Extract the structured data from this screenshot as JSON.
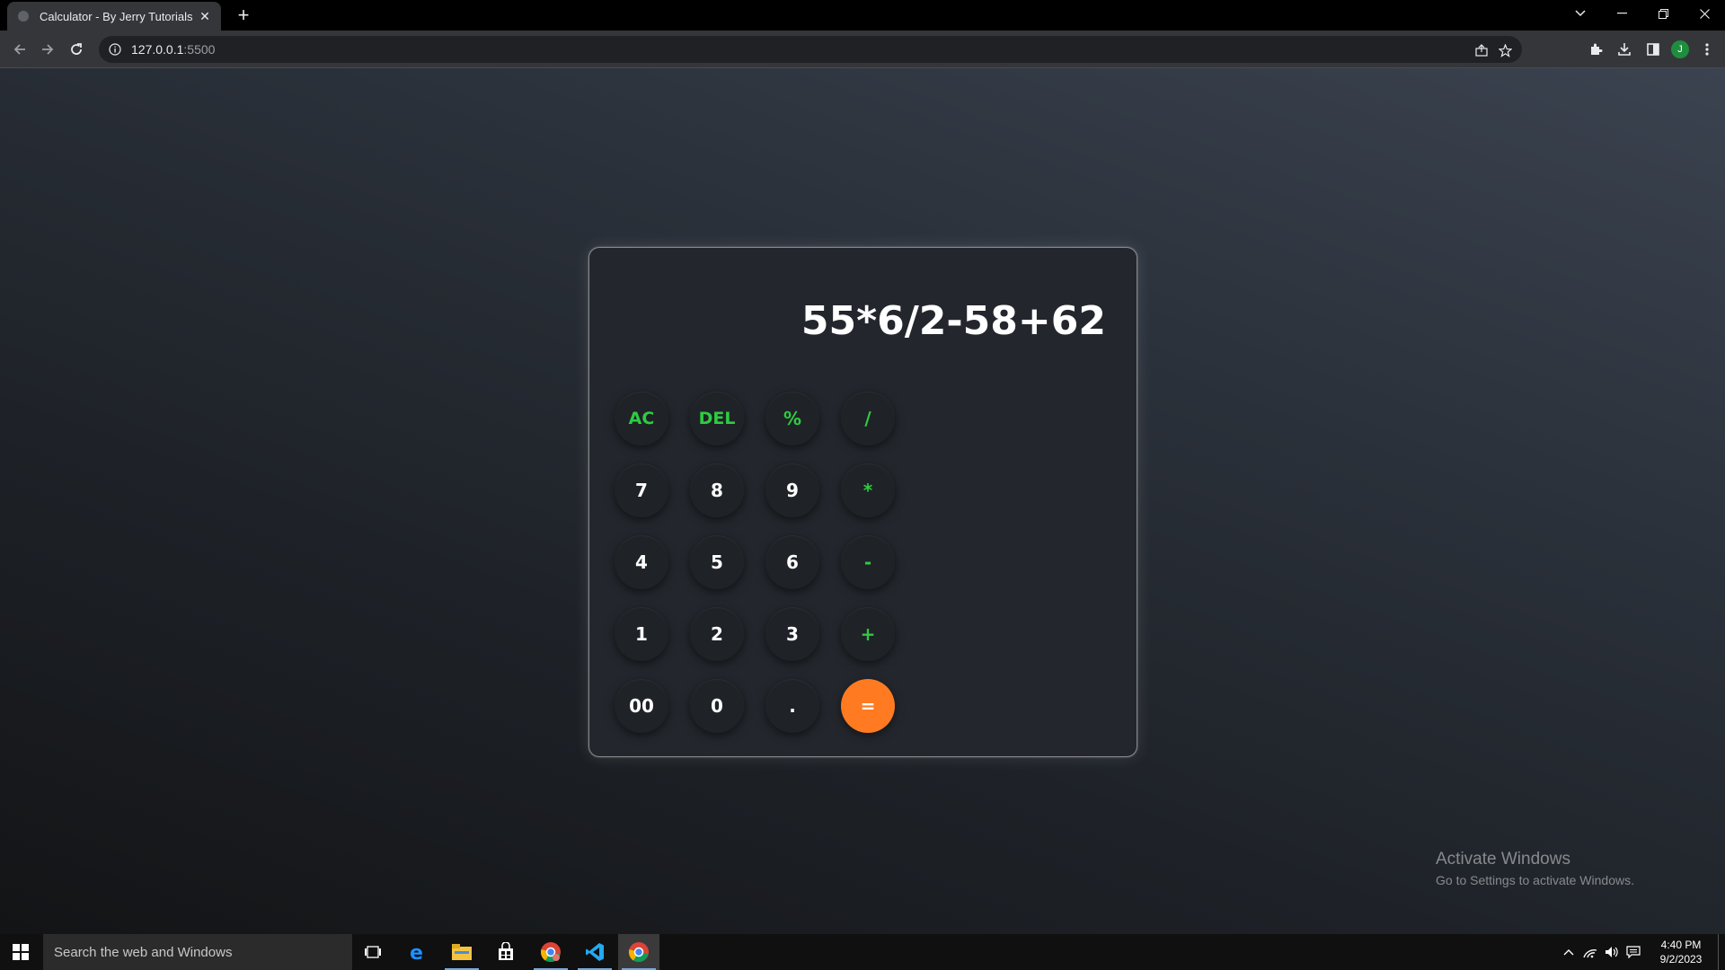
{
  "browser": {
    "tab_title": "Calculator - By Jerry Tutorials",
    "url_host": "127.0.0.1",
    "url_port": ":5500",
    "profile_initial": "J"
  },
  "calculator": {
    "display": "55*6/2-58+62",
    "keys": [
      {
        "label": "AC",
        "kind": "fn"
      },
      {
        "label": "DEL",
        "kind": "fn"
      },
      {
        "label": "%",
        "kind": "op"
      },
      {
        "label": "/",
        "kind": "op"
      },
      {
        "label": "7",
        "kind": "num"
      },
      {
        "label": "8",
        "kind": "num"
      },
      {
        "label": "9",
        "kind": "num"
      },
      {
        "label": "*",
        "kind": "op"
      },
      {
        "label": "4",
        "kind": "num"
      },
      {
        "label": "5",
        "kind": "num"
      },
      {
        "label": "6",
        "kind": "num"
      },
      {
        "label": "-",
        "kind": "op"
      },
      {
        "label": "1",
        "kind": "num"
      },
      {
        "label": "2",
        "kind": "num"
      },
      {
        "label": "3",
        "kind": "num"
      },
      {
        "label": "+",
        "kind": "op"
      },
      {
        "label": "00",
        "kind": "num"
      },
      {
        "label": "0",
        "kind": "num"
      },
      {
        "label": ".",
        "kind": "num"
      },
      {
        "label": "=",
        "kind": "equals"
      }
    ],
    "colors": {
      "accent_green": "#2ecc40",
      "equals_orange": "#ff7a21"
    }
  },
  "watermark": {
    "title": "Activate Windows",
    "subtitle": "Go to Settings to activate Windows."
  },
  "taskbar": {
    "search_placeholder": "Search the web and Windows",
    "time": "4:40 PM",
    "date": "9/2/2023"
  }
}
